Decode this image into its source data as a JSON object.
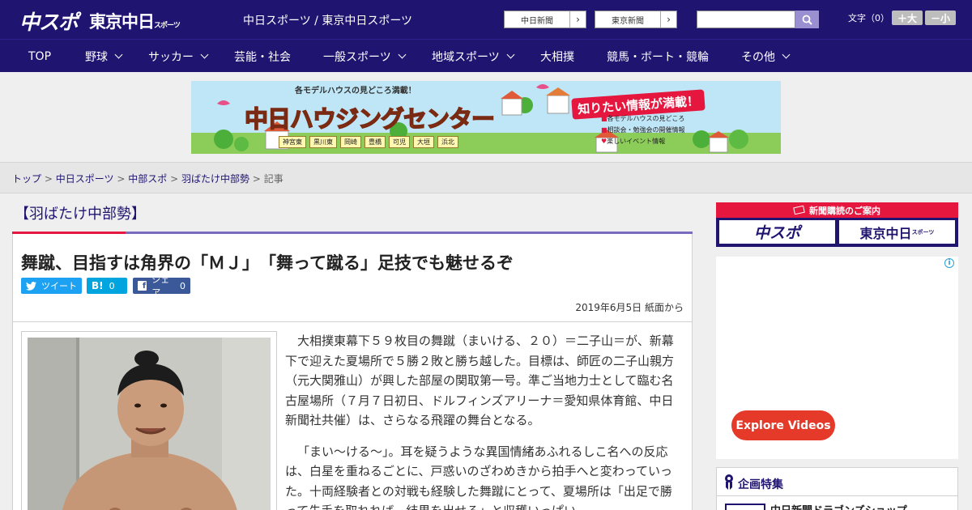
{
  "header": {
    "logo_main": "中スポ",
    "logo_tokyo": "東京中日",
    "logo_tokyo_small": "スポーツ",
    "site_title": "中日スポーツ / 東京中日スポーツ",
    "paper_links": [
      "中日新聞",
      "東京新聞"
    ],
    "fontsize_label": "文字（0）",
    "fontsize_larger": "＋大",
    "fontsize_smaller": "－小"
  },
  "nav": {
    "items": [
      {
        "label": "TOP",
        "dropdown": false
      },
      {
        "label": "野球",
        "dropdown": true
      },
      {
        "label": "サッカー",
        "dropdown": true
      },
      {
        "label": "芸能・社会",
        "dropdown": false
      },
      {
        "label": "一般スポーツ",
        "dropdown": true
      },
      {
        "label": "地域スポーツ",
        "dropdown": true
      },
      {
        "label": "大相撲",
        "dropdown": false
      },
      {
        "label": "競馬・ボート・競輪",
        "dropdown": false
      },
      {
        "label": "その他",
        "dropdown": true
      }
    ]
  },
  "banner": {
    "top_text": "各モデルハウスの見どころ満載！",
    "title": "中日ハウジングセンター",
    "catch": "知りたい情報が満載！",
    "locations": [
      "神宮東",
      "黒川東",
      "岡崎",
      "豊橋",
      "可児",
      "大垣",
      "浜北"
    ],
    "features": [
      "各モデルハウスの見どころ",
      "相談会・勉強会の開催情報",
      "楽しいイベント情報"
    ]
  },
  "breadcrumb": {
    "links": [
      "トップ",
      "中日スポーツ",
      "中部スポ",
      "羽ばたけ中部勢"
    ],
    "current": "記事",
    "separator": ">"
  },
  "section": {
    "title": "【羽ばたけ中部勢】"
  },
  "article": {
    "headline": "舞蹴、目指すは角界の「ＭＪ」　「舞って蹴る」足技でも魅せるぞ",
    "share": {
      "tweet": "ツイート",
      "hatena_icon": "B!",
      "hatena_count": "0",
      "facebook": "シェア",
      "facebook_count": "0"
    },
    "dateline": "2019年6月5日 紙面から",
    "paragraphs": [
      "大相撲東幕下５９枚目の舞蹴（まいける、２０）＝二子山＝が、新幕下で迎えた夏場所で５勝２敗と勝ち越した。目標は、師匠の二子山親方（元大関雅山）が興した部屋の関取第一号。準ご当地力士として臨む名古屋場所（７月７日初日、ドルフィンズアリーナ＝愛知県体育館、中日新聞社共催）は、さらなる飛躍の舞台となる。",
      "「まい～ける～」。耳を疑うような異国情緒あふれるしこ名への反応は、白星を重ねるごとに、戸惑いのざわめきから拍手へと変わっていった。十両経験者との対戦も経験した舞蹴にとって、夏場所は「出足で勝って先手を取れれば、結果を出せる」と収穫いっぱい"
    ]
  },
  "sidebar": {
    "subscription_title": "新聞購読のご案内",
    "subscription_logos": [
      "中スポ",
      "東京中日"
    ],
    "subscription_logo_small": "スポーツ",
    "ad_button": "Explore Videos",
    "ad_info_icon": "i",
    "feature_title": "企画特集",
    "feature_first_item": "中日新聞ドラゴンズショップ"
  },
  "colors": {
    "brand_navy": "#1f1470",
    "accent_red": "#e5173f",
    "accent_purple": "#7a6bbf",
    "twitter_blue": "#1da1f2",
    "hatena_blue": "#00a4de",
    "facebook_blue": "#3b5998",
    "explore_red": "#e53a2a"
  }
}
